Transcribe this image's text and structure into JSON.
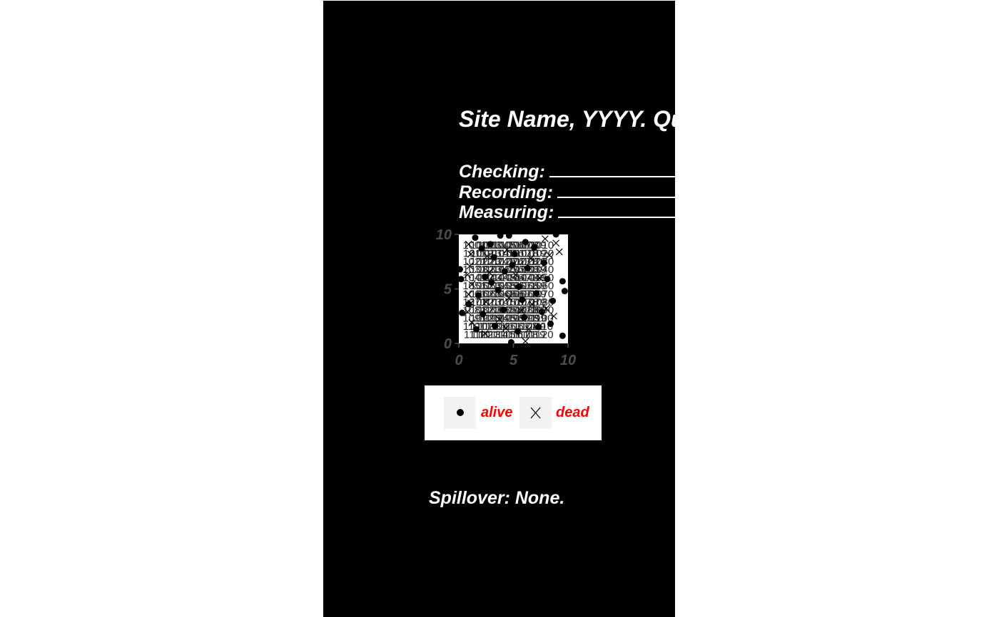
{
  "title": "Site Name, YYYY. Quadrat",
  "roles": [
    {
      "label": "Checking:"
    },
    {
      "label": "Recording:"
    },
    {
      "label": "Measuring:"
    }
  ],
  "legend": {
    "items": [
      {
        "label": "alive",
        "symbol": "filled-circle"
      },
      {
        "label": "dead",
        "symbol": "cross"
      }
    ]
  },
  "footer": {
    "text": "Spillover: None."
  },
  "colors": {
    "background": "#000000",
    "text": "#ffffff",
    "legend_text": "#ff0000",
    "axis_text": "#4d4d4d",
    "plot_panel": "#ffffff",
    "marks": "#000000"
  },
  "chart_data": {
    "type": "scatter",
    "title": "",
    "xlabel": "",
    "ylabel": "",
    "xlim": [
      0,
      10
    ],
    "ylim": [
      0,
      10
    ],
    "xticks": [
      0,
      5,
      10
    ],
    "yticks": [
      0,
      5,
      10
    ],
    "grid": false,
    "legend_position": "bottom",
    "series": [
      {
        "name": "alive",
        "marker": "filled-circle",
        "points": [
          [
            1.5,
            9.7
          ],
          [
            3.8,
            9.9
          ],
          [
            4.6,
            9.9
          ],
          [
            8.9,
            10.0
          ],
          [
            0.1,
            6.8
          ],
          [
            0.2,
            5.9
          ],
          [
            9.7,
            4.8
          ],
          [
            9.5,
            5.7
          ],
          [
            0.3,
            2.8
          ],
          [
            0.9,
            3.6
          ],
          [
            9.5,
            0.7
          ],
          [
            4.8,
            0.1
          ],
          [
            2.1,
            8.7
          ],
          [
            3.2,
            7.9
          ],
          [
            5.1,
            8.2
          ],
          [
            6.9,
            8.8
          ],
          [
            7.8,
            7.4
          ],
          [
            2.4,
            6.1
          ],
          [
            4.2,
            6.6
          ],
          [
            6.3,
            6.9
          ],
          [
            8.1,
            5.9
          ],
          [
            1.8,
            4.4
          ],
          [
            3.6,
            4.9
          ],
          [
            5.5,
            5.2
          ],
          [
            7.1,
            4.6
          ],
          [
            8.6,
            3.9
          ],
          [
            2.2,
            2.7
          ],
          [
            4.1,
            3.1
          ],
          [
            6.0,
            2.4
          ],
          [
            7.6,
            2.9
          ],
          [
            1.6,
            1.3
          ],
          [
            3.3,
            1.6
          ],
          [
            5.4,
            1.1
          ],
          [
            7.3,
            1.5
          ],
          [
            8.4,
            1.8
          ],
          [
            2.9,
            9.1
          ],
          [
            6.1,
            9.3
          ],
          [
            4.9,
            7.2
          ],
          [
            5.8,
            4.0
          ],
          [
            3.0,
            5.6
          ]
        ]
      },
      {
        "name": "dead",
        "marker": "cross",
        "points": [
          [
            0.9,
            9.1
          ],
          [
            1.1,
            8.2
          ],
          [
            1.0,
            7.1
          ],
          [
            0.8,
            6.3
          ],
          [
            1.2,
            5.4
          ],
          [
            0.9,
            4.5
          ],
          [
            1.1,
            3.7
          ],
          [
            0.8,
            2.9
          ],
          [
            1.2,
            1.9
          ],
          [
            8.9,
            9.2
          ],
          [
            6.1,
            0.2
          ],
          [
            9.2,
            8.4
          ],
          [
            2.6,
            8.0
          ],
          [
            4.4,
            8.6
          ],
          [
            6.6,
            7.8
          ],
          [
            8.3,
            8.1
          ],
          [
            2.8,
            6.5
          ],
          [
            5.2,
            6.3
          ],
          [
            7.4,
            6.0
          ],
          [
            2.5,
            3.8
          ],
          [
            4.6,
            4.2
          ],
          [
            6.7,
            3.6
          ],
          [
            8.0,
            3.2
          ],
          [
            3.7,
            2.2
          ],
          [
            5.7,
            3.0
          ],
          [
            2.4,
            0.9
          ],
          [
            4.3,
            1.4
          ],
          [
            6.4,
            1.3
          ],
          [
            8.7,
            2.5
          ],
          [
            7.9,
            9.6
          ]
        ]
      }
    ],
    "point_labels": [
      "1001",
      "1002",
      "1003",
      "1004",
      "1005",
      "1006",
      "1007",
      "1008",
      "1009",
      "1010",
      "1011",
      "1012",
      "1013",
      "1014",
      "1015",
      "1016",
      "1017",
      "1018",
      "1019",
      "1020",
      "1021",
      "1022",
      "1023",
      "1024",
      "1025",
      "1026",
      "1027",
      "1028",
      "1029",
      "1030",
      "1031",
      "1032",
      "1033",
      "1034",
      "1035",
      "1036",
      "1037",
      "1038",
      "1039",
      "1040",
      "1041",
      "1042",
      "1043",
      "1044",
      "1045",
      "1046",
      "1047",
      "1048",
      "1049",
      "1050",
      "1051",
      "1052",
      "1053",
      "1054",
      "1055",
      "1056",
      "1057",
      "1058",
      "1059",
      "1060",
      "1061",
      "1062",
      "1063",
      "1064",
      "1065",
      "1066",
      "1067",
      "1068",
      "1069",
      "1070",
      "1071",
      "1072",
      "1073",
      "1074",
      "1075",
      "1076",
      "1077",
      "1078",
      "1079",
      "1080",
      "1081",
      "1082",
      "1083",
      "1084",
      "1085",
      "1086",
      "1087",
      "1088",
      "1089",
      "1090",
      "1091",
      "1092",
      "1093",
      "1094",
      "1095",
      "1096",
      "1097",
      "1098",
      "1099",
      "1100",
      "1101",
      "1102",
      "1103",
      "1104",
      "1105",
      "1106",
      "1107",
      "1108",
      "1109",
      "1110",
      "1111",
      "1112",
      "1113",
      "1114",
      "1115",
      "1116",
      "1117",
      "1118",
      "1119",
      "1120"
    ]
  }
}
